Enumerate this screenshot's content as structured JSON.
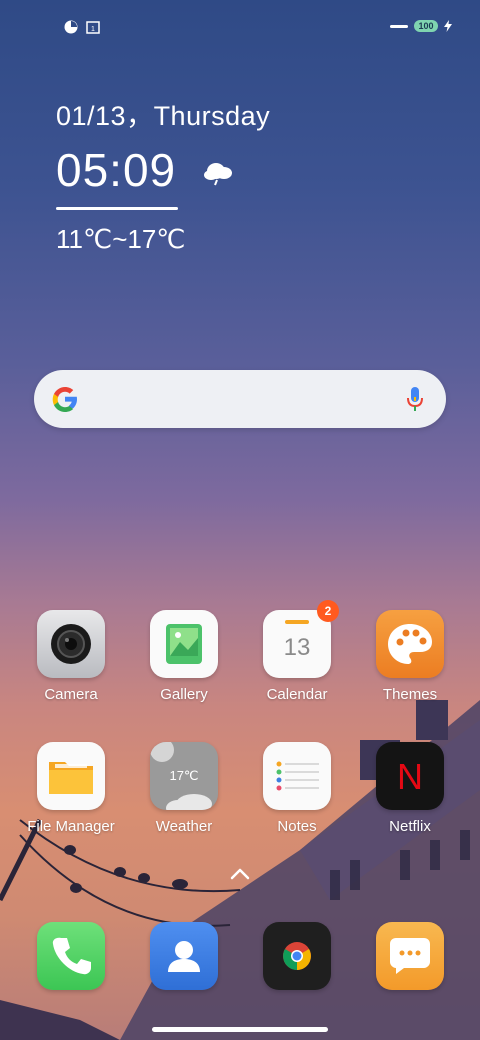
{
  "status": {
    "battery": "100"
  },
  "clock": {
    "date": "01/13，Thursday",
    "time": "05:09",
    "temp_range": "11℃~17℃"
  },
  "apps_row1": [
    {
      "label": "Camera"
    },
    {
      "label": "Gallery"
    },
    {
      "label": "Calendar",
      "icon_text": "13",
      "badge": "2"
    },
    {
      "label": "Themes"
    }
  ],
  "apps_row2": [
    {
      "label": "File Manager"
    },
    {
      "label": "Weather",
      "icon_text": "17℃"
    },
    {
      "label": "Notes"
    },
    {
      "label": "Netflix",
      "icon_text": "N"
    }
  ],
  "dock": [
    {
      "name": "phone"
    },
    {
      "name": "contacts"
    },
    {
      "name": "chrome"
    },
    {
      "name": "messages"
    }
  ],
  "colors": {
    "gallery": "#4cc26a",
    "themes": "#f08a2c",
    "phone": "#4cd964",
    "contacts": "#3d7fe0",
    "messages": "#f7a63a",
    "netflix": "#e50914"
  }
}
